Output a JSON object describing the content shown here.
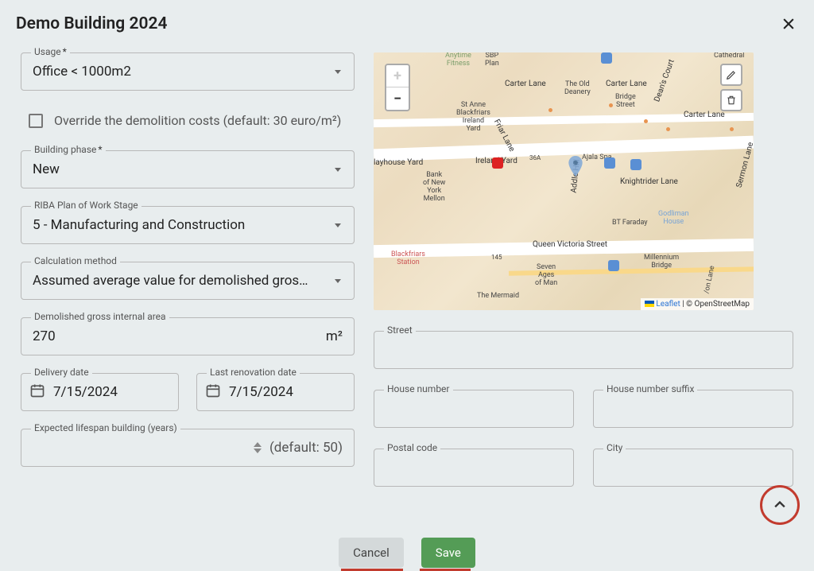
{
  "header": {
    "title": "Demo Building 2024"
  },
  "left": {
    "usage": {
      "label": "Usage",
      "required": true,
      "value": "Office < 1000m2"
    },
    "overrideCheckbox": {
      "label": "Override the demolition costs (default: 30 euro/m²)",
      "checked": false
    },
    "buildingPhase": {
      "label": "Building phase",
      "required": true,
      "value": "New"
    },
    "ribaStage": {
      "label": "RIBA Plan of Work Stage",
      "value": "5 - Manufacturing and Construction"
    },
    "calcMethod": {
      "label": "Calculation method",
      "value": "Assumed average value for demolished gros…"
    },
    "demolishedArea": {
      "label": "Demolished gross internal area",
      "value": "270",
      "unit": "m²"
    },
    "deliveryDate": {
      "label": "Delivery date",
      "value": "7/15/2024"
    },
    "lastRenovation": {
      "label": "Last renovation date",
      "value": "7/15/2024"
    },
    "lifespan": {
      "label": "Expected lifespan building (years)",
      "value": "",
      "defaultHint": "(default: 50)"
    }
  },
  "right": {
    "street": {
      "label": "Street",
      "value": ""
    },
    "houseNumber": {
      "label": "House number",
      "value": ""
    },
    "houseNumberSuffix": {
      "label": "House number suffix",
      "value": ""
    },
    "postalCode": {
      "label": "Postal code",
      "value": ""
    },
    "city": {
      "label": "City",
      "value": ""
    }
  },
  "map": {
    "roads": {
      "carterLane": "Carter Lane",
      "queenVictoria": "Queen Victoria Street",
      "friarLane": "Friar Lane",
      "irelandYard": "Ireland Yard",
      "addleHill": "Addle Hill",
      "knightriderLane": "Knightrider Lane",
      "sermonLane": "Sermon Lane",
      "deansCourt": "Dean's Court",
      "playhouseYard": "layhouse Yard"
    },
    "places": {
      "oldDeanery": "The Old\nDeanery",
      "bridgeStreet": "Bridge\nStreet",
      "blackfriars": "St Anne\nBlackfriars\nIreland\nYard",
      "bankNyMellon": "Bank\nof New\nYork\nMellon",
      "btFaraday": "BT Faraday",
      "godlimanHouse": "Godliman\nHouse",
      "ajalaSpa": "Ajala Spa",
      "anytimeFitness": "Anytime\nFitness",
      "sbpPlan": "SBP\nPlan",
      "blackfriarsStation": "Blackfriars\nStation",
      "millenniumBridge": "Millennium\nBridge",
      "sevenAges": "Seven\nAges\nof Man",
      "mermaid": "The Mermaid",
      "onLane": "/on Lane",
      "cathedral": "Cathedral",
      "n36a": "36A",
      "n145": "145"
    },
    "attribution": {
      "leaflet": "Leaflet",
      "separator": " | ",
      "osm": "© OpenStreetMap"
    }
  },
  "footer": {
    "cancel": "Cancel",
    "save": "Save"
  }
}
